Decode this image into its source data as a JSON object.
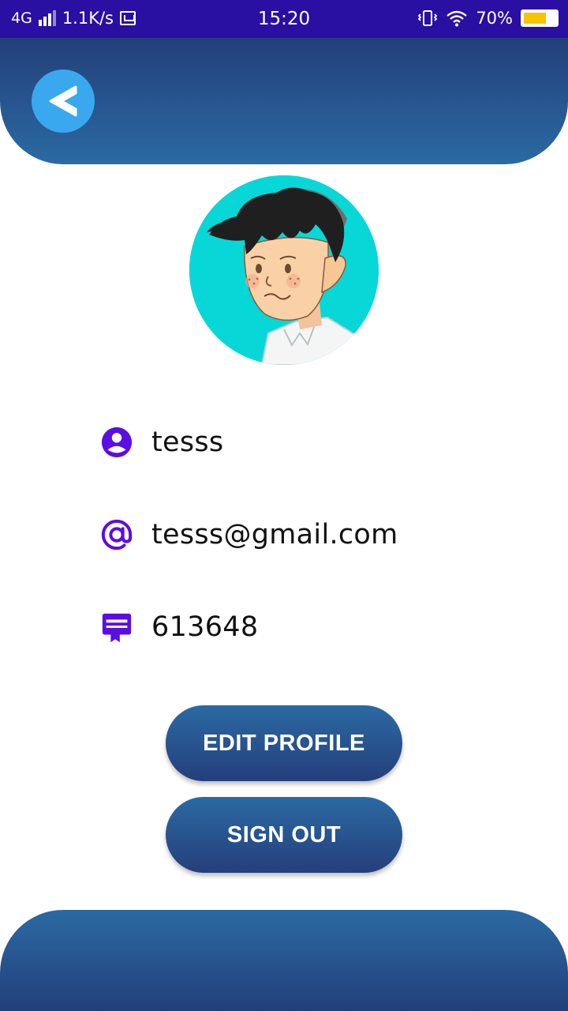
{
  "status_bar": {
    "network": "4G",
    "speed": "1.1K/s",
    "time": "15:20",
    "battery": "70%",
    "battery_level": 0.7,
    "icons": [
      "signal-icon",
      "message-icon",
      "vibrate-icon",
      "wifi-icon",
      "battery-icon"
    ]
  },
  "header": {
    "back_icon": "chevron-left-icon"
  },
  "profile": {
    "avatar": "cartoon-boy-avatar",
    "username": "tesss",
    "email": "tesss@gmail.com",
    "id_number": "613648",
    "icons": {
      "username": "account-circle-icon",
      "email": "at-sign-icon",
      "id": "badge-card-icon"
    }
  },
  "actions": {
    "edit_profile": "EDIT PROFILE",
    "sign_out": "SIGN OUT"
  },
  "colors": {
    "status_bar": "#2a0fa3",
    "header_gradient_top": "#233f7a",
    "header_gradient_bottom": "#2b6aa3",
    "back_button": "#3aa8ef",
    "icon_accent": "#5b0ee3",
    "avatar_bg": "#08d7d8"
  }
}
